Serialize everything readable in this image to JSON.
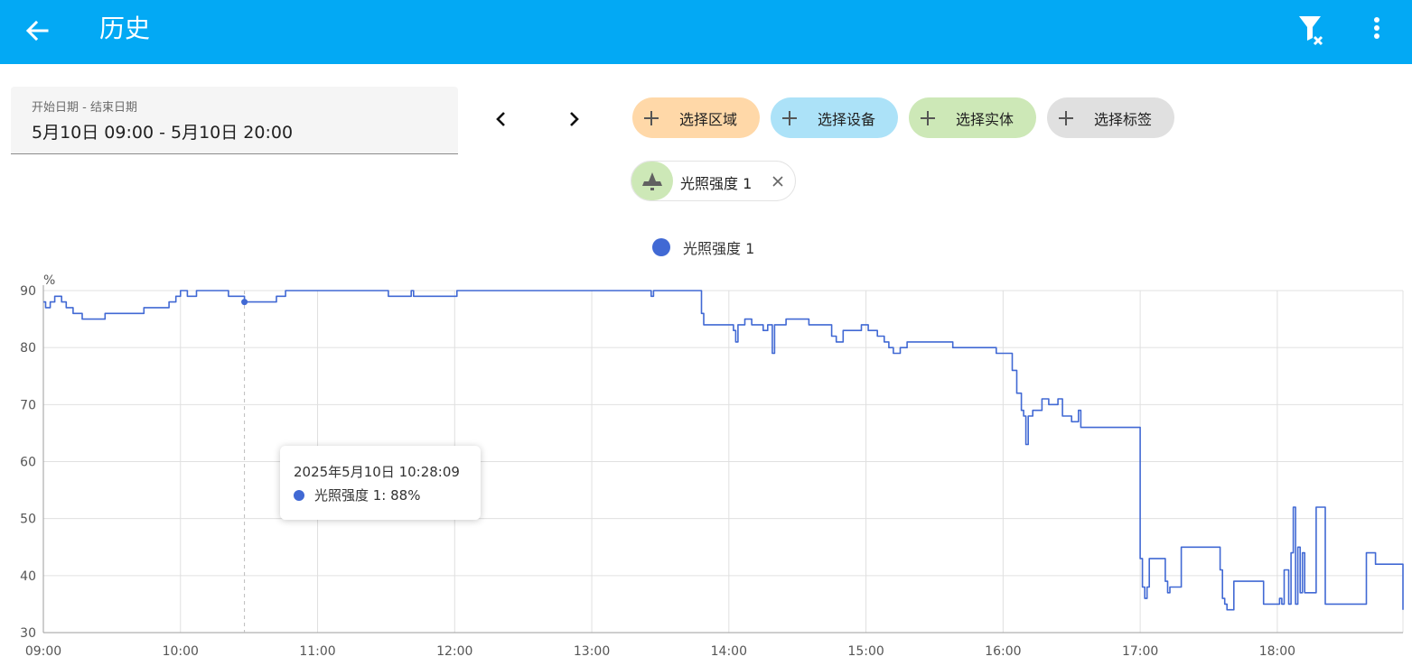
{
  "header": {
    "title": "历史",
    "back_icon": "arrow-left-icon",
    "filter_icon": "filter-remove-icon",
    "more_icon": "dots-vertical-icon"
  },
  "date_range": {
    "label": "开始日期 - 结束日期",
    "value": "5月10日 09:00 - 5月10日 20:00"
  },
  "chips": {
    "area": "选择区域",
    "device": "选择设备",
    "entity": "选择实体",
    "label": "选择标签"
  },
  "selected_entity": {
    "name": "光照强度 1",
    "icon": "bell-icon"
  },
  "legend": {
    "name": "光照强度 1"
  },
  "tooltip": {
    "time": "2025年5月10日 10:28:09",
    "text": "光照强度 1: 88%"
  },
  "colors": {
    "header": "#03a9f4",
    "series": "#4169d4",
    "chip_area": "#ffd8a8",
    "chip_device": "#ace2f8",
    "chip_entity": "#cde8b7",
    "chip_label": "#e0e0e0"
  },
  "chart_data": {
    "type": "line",
    "ylabel": "%",
    "ylim": [
      30,
      90
    ],
    "y_ticks": [
      "30",
      "40",
      "50",
      "60",
      "70",
      "80",
      "90"
    ],
    "x_ticks": [
      "09:00",
      "10:00",
      "11:00",
      "12:00",
      "13:00",
      "14:00",
      "15:00",
      "16:00",
      "17:00",
      "18:00"
    ],
    "xlim": [
      "09:00",
      "18:55"
    ],
    "grid": true,
    "legend": "top-center",
    "hover": {
      "x": "10:28",
      "y": 88
    },
    "series": [
      {
        "name": "光照强度 1",
        "points": [
          [
            "09:00",
            88
          ],
          [
            "09:01",
            87
          ],
          [
            "09:03",
            88
          ],
          [
            "09:05",
            89
          ],
          [
            "09:08",
            88
          ],
          [
            "09:10",
            87
          ],
          [
            "09:13",
            86
          ],
          [
            "09:17",
            85
          ],
          [
            "09:24",
            85
          ],
          [
            "09:27",
            86
          ],
          [
            "09:38",
            86
          ],
          [
            "09:44",
            87
          ],
          [
            "09:52",
            87
          ],
          [
            "09:55",
            88
          ],
          [
            "09:58",
            89
          ],
          [
            "10:00",
            90
          ],
          [
            "10:03",
            89
          ],
          [
            "10:07",
            90
          ],
          [
            "10:18",
            90
          ],
          [
            "10:21",
            89
          ],
          [
            "10:28",
            88
          ],
          [
            "10:40",
            88
          ],
          [
            "10:42",
            89
          ],
          [
            "10:46",
            90
          ],
          [
            "11:30",
            90
          ],
          [
            "11:31",
            89
          ],
          [
            "11:40",
            89
          ],
          [
            "11:41",
            90
          ],
          [
            "11:42",
            89
          ],
          [
            "12:00",
            89
          ],
          [
            "12:01",
            90
          ],
          [
            "13:25",
            90
          ],
          [
            "13:26",
            89
          ],
          [
            "13:27",
            90
          ],
          [
            "13:47",
            90
          ],
          [
            "13:48",
            86
          ],
          [
            "13:49",
            84
          ],
          [
            "14:00",
            84
          ],
          [
            "14:02",
            83
          ],
          [
            "14:03",
            81
          ],
          [
            "14:04",
            84
          ],
          [
            "14:07",
            85
          ],
          [
            "14:10",
            84
          ],
          [
            "14:15",
            83
          ],
          [
            "14:17",
            84
          ],
          [
            "14:19",
            79
          ],
          [
            "14:20",
            84
          ],
          [
            "14:25",
            85
          ],
          [
            "14:33",
            85
          ],
          [
            "14:35",
            84
          ],
          [
            "14:40",
            84
          ],
          [
            "14:45",
            82
          ],
          [
            "14:47",
            81
          ],
          [
            "14:50",
            83
          ],
          [
            "14:58",
            84
          ],
          [
            "15:01",
            83
          ],
          [
            "15:05",
            82
          ],
          [
            "15:08",
            81
          ],
          [
            "15:10",
            80
          ],
          [
            "15:12",
            79
          ],
          [
            "15:15",
            80
          ],
          [
            "15:18",
            81
          ],
          [
            "15:35",
            81
          ],
          [
            "15:38",
            80
          ],
          [
            "15:55",
            80
          ],
          [
            "15:57",
            79
          ],
          [
            "16:01",
            79
          ],
          [
            "16:04",
            76
          ],
          [
            "16:06",
            72
          ],
          [
            "16:08",
            69
          ],
          [
            "16:09",
            68
          ],
          [
            "16:10",
            63
          ],
          [
            "16:11",
            68
          ],
          [
            "16:13",
            69
          ],
          [
            "16:17",
            71
          ],
          [
            "16:20",
            70
          ],
          [
            "16:24",
            71
          ],
          [
            "16:26",
            68
          ],
          [
            "16:30",
            67
          ],
          [
            "16:33",
            69
          ],
          [
            "16:34",
            66
          ],
          [
            "16:59",
            66
          ],
          [
            "17:00",
            43
          ],
          [
            "17:01",
            38
          ],
          [
            "17:02",
            36
          ],
          [
            "17:03",
            38
          ],
          [
            "17:04",
            43
          ],
          [
            "17:10",
            43
          ],
          [
            "17:11",
            39
          ],
          [
            "17:12",
            37
          ],
          [
            "17:13",
            38
          ],
          [
            "17:17",
            38
          ],
          [
            "17:18",
            45
          ],
          [
            "17:34",
            45
          ],
          [
            "17:35",
            41
          ],
          [
            "17:36",
            36
          ],
          [
            "17:37",
            35
          ],
          [
            "17:38",
            34
          ],
          [
            "17:40",
            34
          ],
          [
            "17:41",
            39
          ],
          [
            "17:53",
            39
          ],
          [
            "17:54",
            35
          ],
          [
            "18:00",
            35
          ],
          [
            "18:01",
            36
          ],
          [
            "18:02",
            35
          ],
          [
            "18:03",
            41
          ],
          [
            "18:05",
            35
          ],
          [
            "18:06",
            44
          ],
          [
            "18:07",
            52
          ],
          [
            "18:08",
            35
          ],
          [
            "18:09",
            45
          ],
          [
            "18:10",
            37
          ],
          [
            "18:11",
            44
          ],
          [
            "18:12",
            37
          ],
          [
            "18:16",
            37
          ],
          [
            "18:17",
            52
          ],
          [
            "18:20",
            52
          ],
          [
            "18:21",
            35
          ],
          [
            "18:38",
            35
          ],
          [
            "18:39",
            44
          ],
          [
            "18:42",
            44
          ],
          [
            "18:43",
            42
          ],
          [
            "18:54",
            42
          ],
          [
            "18:55",
            34
          ]
        ]
      }
    ]
  }
}
